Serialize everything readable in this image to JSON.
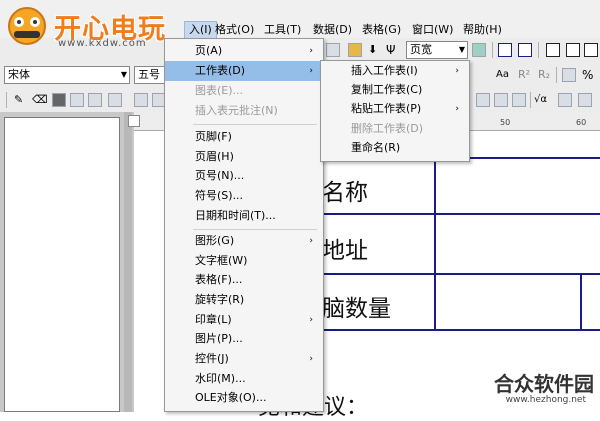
{
  "logo": {
    "brand": "开心电玩",
    "url": "www.kxdw.com"
  },
  "menubar": {
    "items": [
      {
        "label": "入(I)"
      },
      {
        "label": "格式(O)"
      },
      {
        "label": "工具(T)"
      },
      {
        "label": "数据(D)"
      },
      {
        "label": "表格(G)"
      },
      {
        "label": "窗口(W)"
      },
      {
        "label": "帮助(H)"
      }
    ]
  },
  "toolbar": {
    "page_width_combo": "页宽",
    "font_combo": "宋体",
    "size_combo": "五号",
    "superscript": "R²",
    "subscript": "R₂",
    "percent": "%",
    "text_a": "Aa",
    "sqrt": "√α"
  },
  "ruler": {
    "tick_50": "50",
    "tick_60": "60"
  },
  "document": {
    "row1": "名称",
    "row2": "地址",
    "row3": "脑数量",
    "footer_text": "见和建议："
  },
  "insert_menu": {
    "items": [
      {
        "label": "页(A)",
        "submenu": true
      },
      {
        "label": "工作表(D)",
        "submenu": true,
        "highlighted": true
      },
      {
        "label": "图表(E)...",
        "disabled": true
      },
      {
        "label": "插入表元批注(N)",
        "disabled": true
      },
      {
        "label": "页脚(F)"
      },
      {
        "label": "页眉(H)"
      },
      {
        "label": "页号(N)..."
      },
      {
        "label": "符号(S)..."
      },
      {
        "label": "日期和时间(T)..."
      },
      {
        "label": "图形(G)",
        "submenu": true
      },
      {
        "label": "文字框(W)"
      },
      {
        "label": "表格(F)..."
      },
      {
        "label": "旋转字(R)"
      },
      {
        "label": "印章(L)",
        "submenu": true
      },
      {
        "label": "图片(P)..."
      },
      {
        "label": "控件(J)",
        "submenu": true
      },
      {
        "label": "水印(M)..."
      },
      {
        "label": "OLE对象(O)..."
      }
    ]
  },
  "worksheet_menu": {
    "items": [
      {
        "label": "插入工作表(I)",
        "submenu": true
      },
      {
        "label": "复制工作表(C)"
      },
      {
        "label": "粘贴工作表(P)",
        "submenu": true
      },
      {
        "label": "删除工作表(D)",
        "disabled": true
      },
      {
        "label": "重命名(R)"
      }
    ]
  },
  "watermark": {
    "title": "合众软件园",
    "url": "www.hezhong.net"
  },
  "colors": {
    "menu_highlight": "#94bde8",
    "table_line": "#1c1c88",
    "brand_orange": "#f07c1a"
  }
}
